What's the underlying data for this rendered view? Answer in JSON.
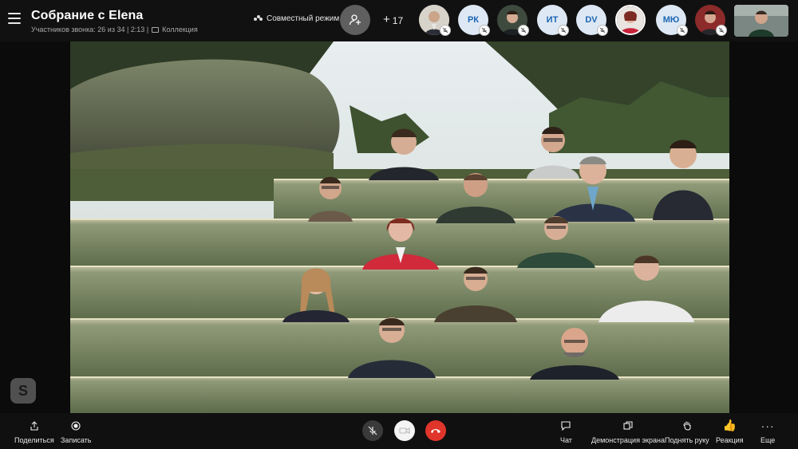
{
  "header": {
    "title": "Собрание с Elena",
    "participants_text": "Участников звонка: 26 из 34 | 2:13 |",
    "collection_label": "Коллекция",
    "mode_label": "Совместный режим",
    "extra_participants": "17",
    "participants": [
      {
        "type": "photo",
        "name": "participant-1"
      },
      {
        "type": "initials",
        "initials": "РК"
      },
      {
        "type": "photo",
        "name": "participant-3"
      },
      {
        "type": "initials",
        "initials": "ИТ"
      },
      {
        "type": "initials",
        "initials": "DV"
      },
      {
        "type": "photo",
        "name": "participant-6"
      },
      {
        "type": "initials",
        "initials": "МЮ"
      },
      {
        "type": "photo",
        "name": "participant-8"
      }
    ]
  },
  "toolbar": {
    "share_label": "Поделиться",
    "record_label": "Записать",
    "chat_label": "Чат",
    "screen_share_label": "Демонстрация экрана",
    "raise_hand_label": "Поднять руку",
    "reaction_label": "Реакция",
    "more_label": "Еще"
  },
  "colors": {
    "hangup": "#e0352b",
    "accent_initials": "#1b65b4",
    "topbar_bg": "#111111"
  },
  "icons": [
    "menu-icon",
    "together-mode-icon",
    "add-people-icon",
    "mic-off-icon",
    "camera-icon",
    "hangup-icon",
    "share-icon",
    "record-icon",
    "chat-icon",
    "screen-share-icon",
    "raise-hand-icon",
    "thumbs-up-icon",
    "more-icon",
    "skype-icon"
  ]
}
